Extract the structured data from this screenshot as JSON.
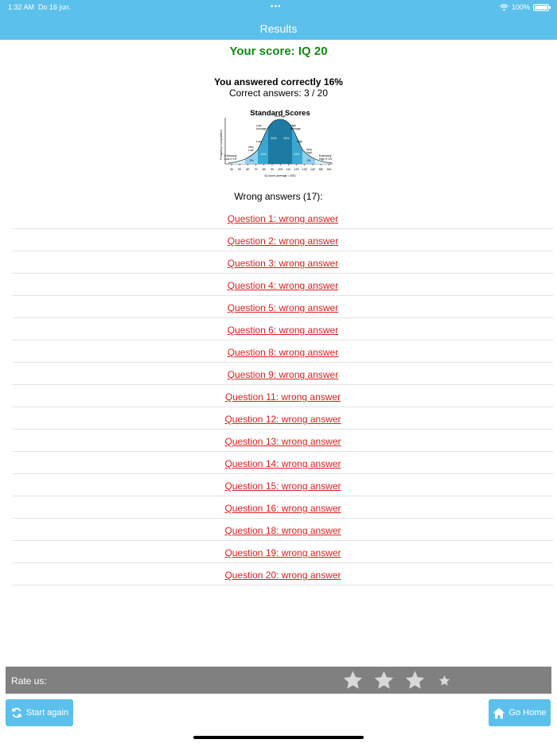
{
  "status_bar": {
    "time": "1:32 AM",
    "date": "Do 16 jun.",
    "battery": "100%"
  },
  "nav": {
    "title": "Results"
  },
  "results": {
    "score": "Your score: IQ 20",
    "percent": "You answered correctly 16%",
    "correct": "Correct answers: 3 / 20",
    "wrong_title": "Wrong answers (17):"
  },
  "chart": {
    "title": "Standard Scores",
    "ylabel": "Frequency in population",
    "xlabel": "IQ score (average = 100)",
    "ticks": [
      "40",
      "50",
      "60",
      "70",
      "80",
      "90",
      "100",
      "110",
      "120",
      "130",
      "140",
      "150",
      "160"
    ],
    "labels": {
      "average": "Average",
      "low_avg_1": "Low",
      "low_avg_2": "Average",
      "high_avg_1": "High",
      "high_avg_2": "Average",
      "low": "Low",
      "high": "High",
      "vlow_1": "Very",
      "vlow_2": "Low",
      "vhigh_1": "Very",
      "vhigh_2": "High",
      "elow_1": "Extremely",
      "elow_2": "Low 0.1%",
      "ehigh_1": "Extremely",
      "ehigh_2": "High 0.1%",
      "p34a": "34%",
      "p34b": "34%",
      "p14a": "14%",
      "p14b": "14%",
      "p2a": "2%",
      "p2b": "2%"
    }
  },
  "wrong_answers": [
    "Question 1: wrong answer",
    "Question 2: wrong answer",
    "Question 3: wrong answer",
    "Question 4: wrong answer",
    "Question 5: wrong answer",
    "Question 6: wrong answer",
    "Question 8: wrong answer",
    "Question 9: wrong answer",
    "Question 11: wrong answer",
    "Question 12: wrong answer",
    "Question 13: wrong answer",
    "Question 14: wrong answer",
    "Question 15: wrong answer",
    "Question 16: wrong answer",
    "Question 18: wrong answer",
    "Question 19: wrong answer",
    "Question 20: wrong answer"
  ],
  "rate": {
    "label": "Rate us:",
    "stars": 4
  },
  "buttons": {
    "start_again": "Start again",
    "go_home": "Go Home"
  },
  "colors": {
    "accent": "#5bc0eb",
    "score_green": "#138a13",
    "link_red": "#e02020",
    "rate_bar": "#808080"
  }
}
